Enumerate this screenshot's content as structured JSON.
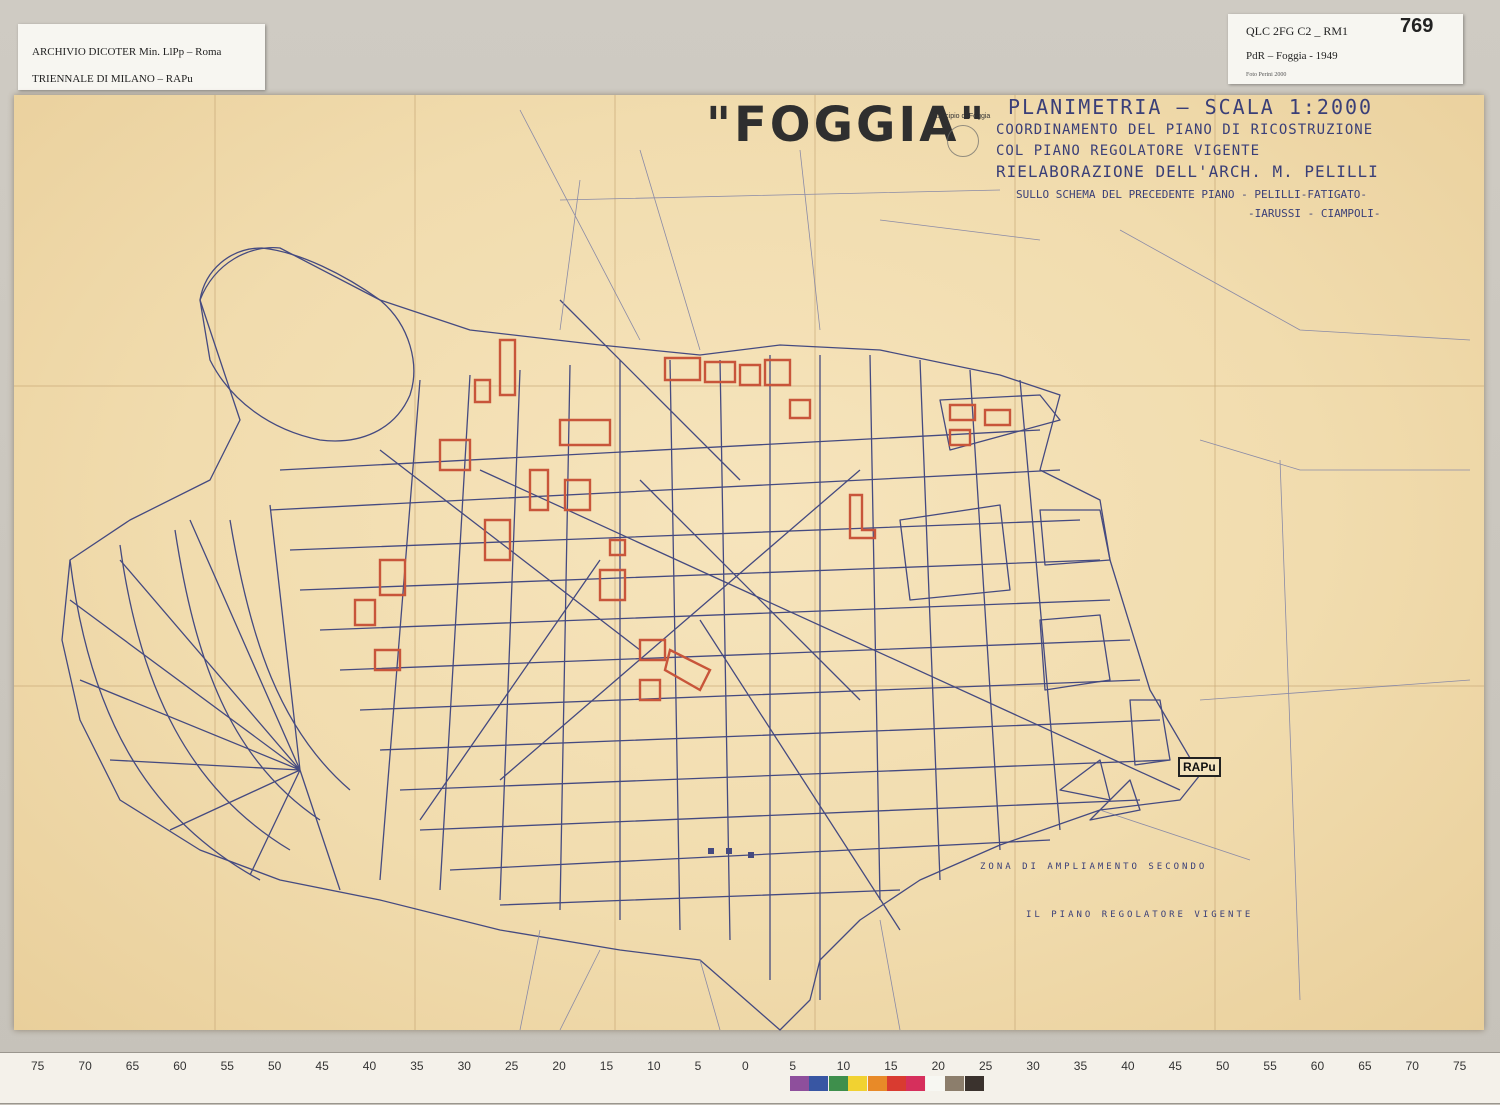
{
  "label_left": {
    "line1": "ARCHIVIO DICOTER Min. LlPp – Roma",
    "line2": "TRIENNALE DI MILANO – RAPu"
  },
  "label_right": {
    "code": "QLC 2FG C2 _ RM1",
    "number": "769",
    "subtitle": "PdR – Foggia - 1949",
    "photo_credit": "Foto Perini 2000"
  },
  "map": {
    "title": "\"FOGGIA\"",
    "stamp_text": "Municipio di Foggia",
    "legend": {
      "line1": "PLANIMETRIA – SCALA 1:2000",
      "line2": "COORDINAMENTO DEL PIANO DI RICOSTRUZIONE",
      "line3": "COL PIANO REGOLATORE VIGENTE",
      "line4": "RIELABORAZIONE DELL'ARCH. M. PELILLI",
      "line5": "SULLO SCHEMA DEL PRECEDENTE PIANO - PELILLI-FATIGATO-",
      "line6": "-IARUSSI - CIAMPOLI-"
    },
    "zone_label_1": "ZONA DI AMPLIAMENTO SECONDO",
    "zone_label_2": "IL PIANO REGOLATORE VIGENTE",
    "rapu_stamp": "RAPu",
    "colors": {
      "paper": "#f1dcae",
      "street_lines": "#454a80",
      "reconstruction_blocks": "#c8553a"
    }
  },
  "scale_bar": {
    "labels": [
      "75",
      "70",
      "65",
      "60",
      "55",
      "50",
      "45",
      "40",
      "35",
      "30",
      "25",
      "20",
      "15",
      "10",
      "5",
      "0",
      "5",
      "10",
      "15",
      "20",
      "25",
      "30",
      "35",
      "40",
      "45",
      "50",
      "55",
      "60",
      "65",
      "70",
      "75"
    ],
    "color_patches": [
      "#8e4f9c",
      "#3856a3",
      "#3e8f4c",
      "#f1d231",
      "#e88a28",
      "#d93b30",
      "#d62f5c",
      "#f7f7f2",
      "#8c7e6c",
      "#3a322d"
    ]
  }
}
